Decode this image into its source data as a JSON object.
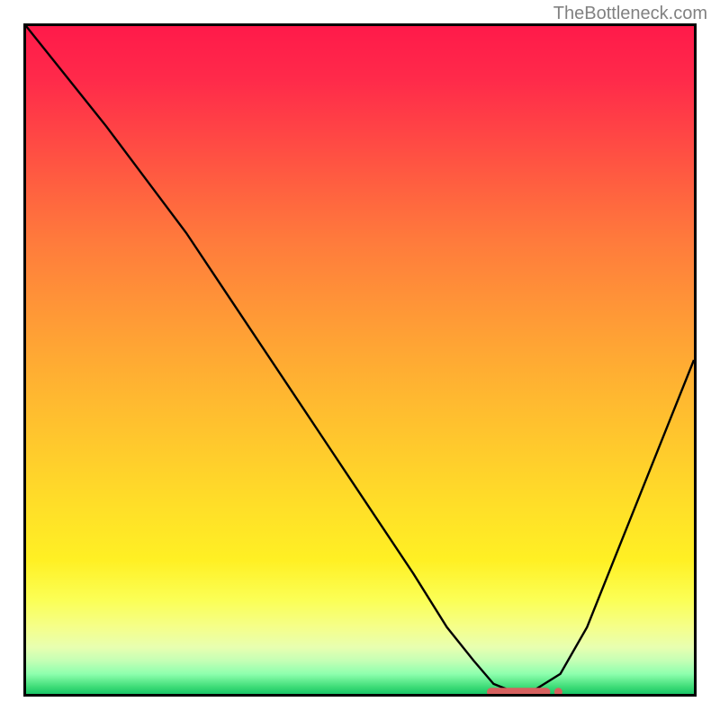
{
  "watermark": "TheBottleneck.com",
  "chart_data": {
    "type": "line",
    "title": "",
    "xlabel": "",
    "ylabel": "",
    "xlim": [
      0,
      100
    ],
    "ylim": [
      0,
      100
    ],
    "series": [
      {
        "name": "curve",
        "x": [
          0,
          6,
          12,
          18,
          24,
          28,
          34,
          40,
          46,
          52,
          58,
          63,
          67,
          70,
          73,
          76,
          80,
          84,
          88,
          92,
          96,
          100
        ],
        "y": [
          100,
          92.5,
          85,
          77,
          69,
          63,
          54,
          45,
          36,
          27,
          18,
          10,
          5,
          1.5,
          0.3,
          0.5,
          3,
          10,
          20,
          30,
          40,
          50
        ],
        "color": "#000000"
      }
    ],
    "markers": {
      "x_range": [
        69,
        78.5
      ],
      "y": 0.3,
      "color": "#d6615f",
      "shape": "rounded-band-with-dot"
    },
    "gradient_colors": {
      "top": "#ff1a4a",
      "mid_upper": "#ff8a3a",
      "mid": "#ffd028",
      "lower": "#fbff56",
      "bottom": "#1ac568"
    }
  }
}
